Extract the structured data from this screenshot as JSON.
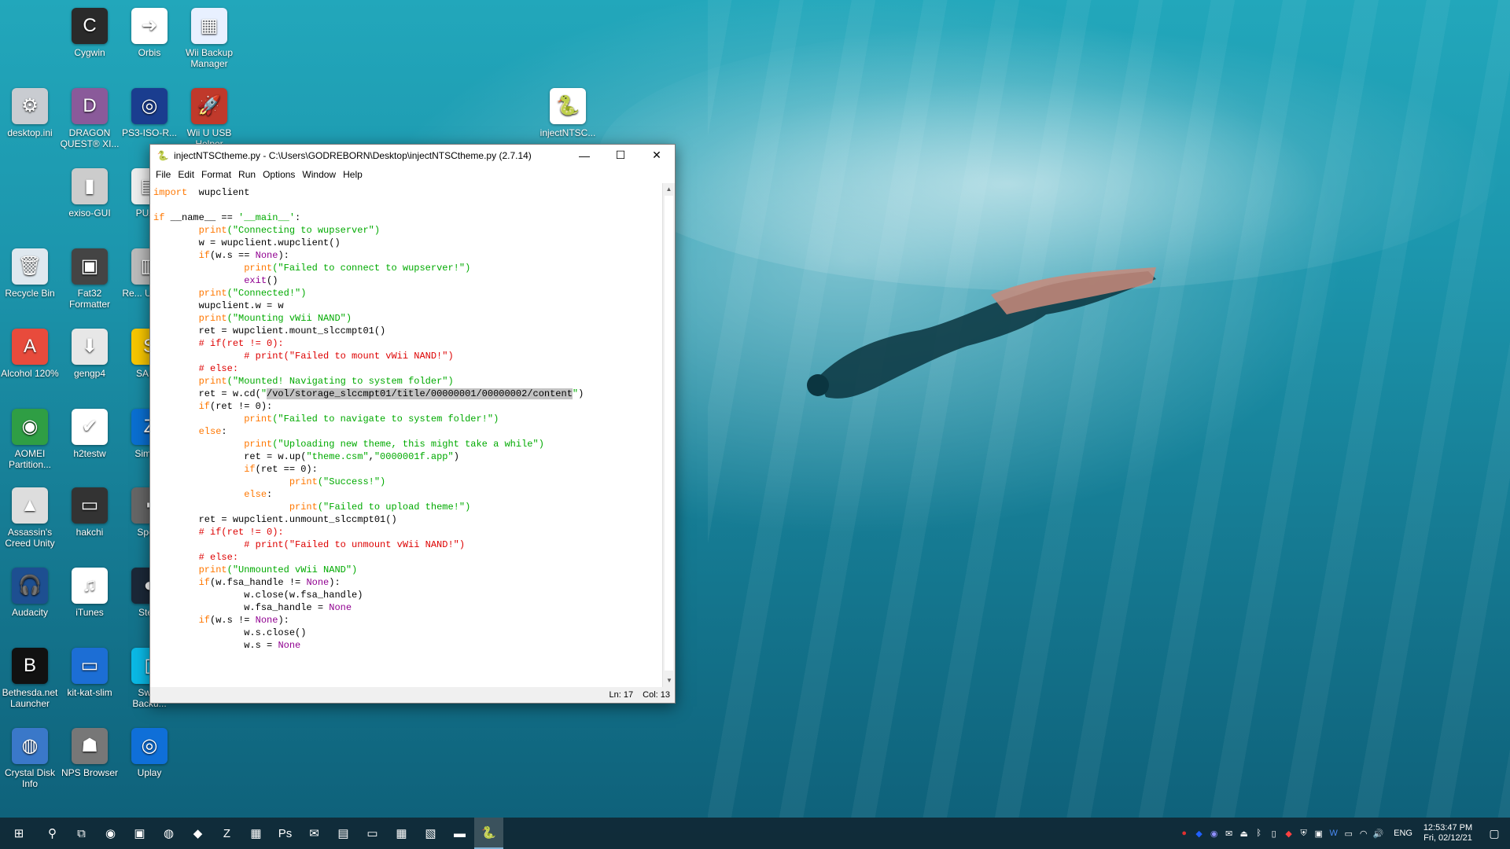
{
  "desktop": {
    "icons": [
      {
        "label": "Cygwin",
        "color": "#2a2a2a",
        "glyph": "C"
      },
      {
        "label": "Orbis",
        "color": "#ffffff",
        "glyph": "➜"
      },
      {
        "label": "Wii Backup Manager",
        "color": "#e8f0ff",
        "glyph": "▦"
      },
      {
        "label": "desktop.ini",
        "color": "#c9ccd1",
        "glyph": "⚙"
      },
      {
        "label": "DRAGON QUEST® XI...",
        "color": "#8a5a9a",
        "glyph": "D"
      },
      {
        "label": "PS3-ISO-R...",
        "color": "#1a3d8f",
        "glyph": "◎"
      },
      {
        "label": "Wii U USB Helper",
        "color": "#c0392b",
        "glyph": "🚀"
      },
      {
        "label": "injectNTSC...",
        "color": "#ffffff",
        "glyph": "🐍"
      },
      {
        "label": "exiso-GUI",
        "color": "#cccccc",
        "glyph": "▮"
      },
      {
        "label": "PUA...",
        "color": "#eeeeee",
        "glyph": "▤"
      },
      {
        "label": "Recycle Bin",
        "color": "#dfe8ef",
        "glyph": "🗑"
      },
      {
        "label": "Fat32 Formatter",
        "color": "#444444",
        "glyph": "▣"
      },
      {
        "label": "Re... Unins...",
        "color": "#bbbbbb",
        "glyph": "▥"
      },
      {
        "label": "Alcohol 120%",
        "color": "#e84b3c",
        "glyph": "A"
      },
      {
        "label": "gengp4",
        "color": "#e7e7e7",
        "glyph": "⬇"
      },
      {
        "label": "SAB...",
        "color": "#f7c600",
        "glyph": "S"
      },
      {
        "label": "AOMEI Partition...",
        "color": "#2f9e44",
        "glyph": "◉"
      },
      {
        "label": "h2testw",
        "color": "#ffffff",
        "glyph": "✔"
      },
      {
        "label": "Simp...",
        "color": "#0a6fd1",
        "glyph": "Z"
      },
      {
        "label": "Assassin's Creed Unity",
        "color": "#dddddd",
        "glyph": "▲"
      },
      {
        "label": "hakchi",
        "color": "#333333",
        "glyph": "▭"
      },
      {
        "label": "Spe...",
        "color": "#666666",
        "glyph": "▪"
      },
      {
        "label": "Audacity",
        "color": "#1d4f91",
        "glyph": "🎧"
      },
      {
        "label": "iTunes",
        "color": "#ffffff",
        "glyph": "♫"
      },
      {
        "label": "Ste...",
        "color": "#1b2838",
        "glyph": "◐"
      },
      {
        "label": "Bethesda.net Launcher",
        "color": "#111111",
        "glyph": "B"
      },
      {
        "label": "kit-kat-slim",
        "color": "#1c6ed5",
        "glyph": "▭"
      },
      {
        "label": "Swi... Backu...",
        "color": "#0ab9e6",
        "glyph": "▯"
      },
      {
        "label": "Crystal Disk Info",
        "color": "#3a78c9",
        "glyph": "◍"
      },
      {
        "label": "NPS Browser",
        "color": "#777777",
        "glyph": "☗"
      },
      {
        "label": "Uplay",
        "color": "#0f6fd8",
        "glyph": "◎"
      }
    ]
  },
  "window": {
    "title": "injectNTSCtheme.py - C:\\Users\\GODREBORN\\Desktop\\injectNTSCtheme.py (2.7.14)",
    "minimize": "—",
    "maximize": "☐",
    "close": "✕",
    "menu": [
      "File",
      "Edit",
      "Format",
      "Run",
      "Options",
      "Window",
      "Help"
    ],
    "status": {
      "line": "Ln: 17",
      "col": "Col: 13"
    }
  },
  "code": [
    [
      [
        "kw",
        "import"
      ],
      [
        "",
        "  wupclient"
      ]
    ],
    [],
    [
      [
        "kw",
        "if"
      ],
      [
        "",
        " __name__ == "
      ],
      [
        "st",
        "'__main__'"
      ],
      [
        "",
        ":"
      ]
    ],
    [
      [
        "",
        "        "
      ],
      [
        "kw",
        "print"
      ],
      [
        "st",
        "(\"Connecting to wupserver\")"
      ]
    ],
    [
      [
        "",
        "        w = wupclient.wupclient()"
      ]
    ],
    [
      [
        "",
        "        "
      ],
      [
        "kw",
        "if"
      ],
      [
        "",
        "(w.s == "
      ],
      [
        "bi",
        "None"
      ],
      [
        "",
        "):"
      ]
    ],
    [
      [
        "",
        "                "
      ],
      [
        "kw",
        "print"
      ],
      [
        "st",
        "(\"Failed to connect to wupserver!\")"
      ]
    ],
    [
      [
        "",
        "                "
      ],
      [
        "bi",
        "exit"
      ],
      [
        "",
        "()"
      ]
    ],
    [
      [
        "",
        "        "
      ],
      [
        "kw",
        "print"
      ],
      [
        "st",
        "(\"Connected!\")"
      ]
    ],
    [
      [
        "",
        "        wupclient.w = w"
      ]
    ],
    [
      [
        "",
        "        "
      ],
      [
        "kw",
        "print"
      ],
      [
        "st",
        "(\"Mounting vWii NAND\")"
      ]
    ],
    [
      [
        "",
        "        ret = wupclient.mount_slccmpt01()"
      ]
    ],
    [
      [
        "",
        "        "
      ],
      [
        "cm",
        "# if(ret != 0):"
      ]
    ],
    [
      [
        "",
        "                "
      ],
      [
        "cm",
        "# print(\"Failed to mount vWii NAND!\")"
      ]
    ],
    [
      [
        "",
        "        "
      ],
      [
        "cm",
        "# else:"
      ]
    ],
    [
      [
        "",
        "        "
      ],
      [
        "kw",
        "print"
      ],
      [
        "st",
        "(\"Mounted! Navigating to system folder\")"
      ]
    ],
    [
      [
        "",
        "        ret = w.cd("
      ],
      [
        "st",
        "\""
      ],
      [
        "sel",
        "/vol/storage_slccmpt01/title/00000001/00000002/content"
      ],
      [
        "st",
        "\""
      ],
      [
        "",
        ")"
      ]
    ],
    [
      [
        "",
        "        "
      ],
      [
        "kw",
        "if"
      ],
      [
        "",
        "(ret != 0):"
      ]
    ],
    [
      [
        "",
        "                "
      ],
      [
        "kw",
        "print"
      ],
      [
        "st",
        "(\"Failed to navigate to system folder!\")"
      ]
    ],
    [
      [
        "",
        "        "
      ],
      [
        "kw",
        "else"
      ],
      [
        "",
        ":"
      ]
    ],
    [
      [
        "",
        "                "
      ],
      [
        "kw",
        "print"
      ],
      [
        "st",
        "(\"Uploading new theme, this might take a while\")"
      ]
    ],
    [
      [
        "",
        "                ret = w.up("
      ],
      [
        "st",
        "\"theme.csm\""
      ],
      [
        "",
        ","
      ],
      [
        "st",
        "\"0000001f.app\""
      ],
      [
        "",
        ")"
      ]
    ],
    [
      [
        "",
        "                "
      ],
      [
        "kw",
        "if"
      ],
      [
        "",
        "(ret == 0):"
      ]
    ],
    [
      [
        "",
        "                        "
      ],
      [
        "kw",
        "print"
      ],
      [
        "st",
        "(\"Success!\")"
      ]
    ],
    [
      [
        "",
        "                "
      ],
      [
        "kw",
        "else"
      ],
      [
        "",
        ":"
      ]
    ],
    [
      [
        "",
        "                        "
      ],
      [
        "kw",
        "print"
      ],
      [
        "st",
        "(\"Failed to upload theme!\")"
      ]
    ],
    [
      [
        "",
        "        ret = wupclient.unmount_slccmpt01()"
      ]
    ],
    [
      [
        "",
        "        "
      ],
      [
        "cm",
        "# if(ret != 0):"
      ]
    ],
    [
      [
        "",
        "                "
      ],
      [
        "cm",
        "# print(\"Failed to unmount vWii NAND!\")"
      ]
    ],
    [
      [
        "",
        "        "
      ],
      [
        "cm",
        "# else:"
      ]
    ],
    [
      [
        "",
        "        "
      ],
      [
        "kw",
        "print"
      ],
      [
        "st",
        "(\"Unmounted vWii NAND\")"
      ]
    ],
    [
      [
        "",
        "        "
      ],
      [
        "kw",
        "if"
      ],
      [
        "",
        "(w.fsa_handle != "
      ],
      [
        "bi",
        "None"
      ],
      [
        "",
        "):"
      ]
    ],
    [
      [
        "",
        "                w.close(w.fsa_handle)"
      ]
    ],
    [
      [
        "",
        "                w.fsa_handle = "
      ],
      [
        "bi",
        "None"
      ]
    ],
    [
      [
        "",
        "        "
      ],
      [
        "kw",
        "if"
      ],
      [
        "",
        "(w.s != "
      ],
      [
        "bi",
        "None"
      ],
      [
        "",
        "):"
      ]
    ],
    [
      [
        "",
        "                w.s.close()"
      ]
    ],
    [
      [
        "",
        "                w.s = "
      ],
      [
        "bi",
        "None"
      ]
    ]
  ],
  "taskbar": {
    "items": [
      {
        "name": "start-button",
        "glyph": "⊞"
      },
      {
        "name": "search-icon",
        "glyph": "⚲"
      },
      {
        "name": "task-view-icon",
        "glyph": "⧉"
      },
      {
        "name": "firefox-icon",
        "glyph": "◉"
      },
      {
        "name": "app-icon",
        "glyph": "▣"
      },
      {
        "name": "chrome-icon",
        "glyph": "◍"
      },
      {
        "name": "msi-icon",
        "glyph": "◆"
      },
      {
        "name": "filezilla-icon",
        "glyph": "Z"
      },
      {
        "name": "app-icon",
        "glyph": "▦"
      },
      {
        "name": "photoshop-icon",
        "glyph": "Ps"
      },
      {
        "name": "mail-icon",
        "glyph": "✉"
      },
      {
        "name": "excel-icon",
        "glyph": "▤"
      },
      {
        "name": "monitor-icon",
        "glyph": "▭"
      },
      {
        "name": "calculator-icon",
        "glyph": "▦"
      },
      {
        "name": "photos-icon",
        "glyph": "▧"
      },
      {
        "name": "file-explorer-icon",
        "glyph": "▬"
      },
      {
        "name": "idle-icon",
        "glyph": "🐍"
      }
    ],
    "tray": [
      {
        "name": "tray-app-icon",
        "glyph": "●",
        "color": "#e03030"
      },
      {
        "name": "tray-app-icon",
        "glyph": "◆",
        "color": "#2060ff"
      },
      {
        "name": "tray-app-icon",
        "glyph": "◉",
        "color": "#9090ff"
      },
      {
        "name": "mail-tray-icon",
        "glyph": "✉",
        "color": "#ffffff"
      },
      {
        "name": "usb-icon",
        "glyph": "⏏",
        "color": "#ffffff"
      },
      {
        "name": "bluetooth-icon",
        "glyph": "ᛒ",
        "color": "#ffffff"
      },
      {
        "name": "phone-icon",
        "glyph": "▯",
        "color": "#ffffff"
      },
      {
        "name": "msi-tray-icon",
        "glyph": "◆",
        "color": "#ff4040"
      },
      {
        "name": "shield-icon",
        "glyph": "⛨",
        "color": "#ffffff"
      },
      {
        "name": "app-tray-icon",
        "glyph": "▣",
        "color": "#ffffff"
      },
      {
        "name": "word-icon",
        "glyph": "W",
        "color": "#4b8bf5"
      },
      {
        "name": "battery-icon",
        "glyph": "▭",
        "color": "#ffffff"
      },
      {
        "name": "wifi-icon",
        "glyph": "◠",
        "color": "#ffffff"
      },
      {
        "name": "volume-icon",
        "glyph": "🔊",
        "color": "#ffffff"
      }
    ],
    "lang": "ENG",
    "time": "12:53:47 PM",
    "date": "Fri, 02/12/21",
    "notif": "▢"
  }
}
